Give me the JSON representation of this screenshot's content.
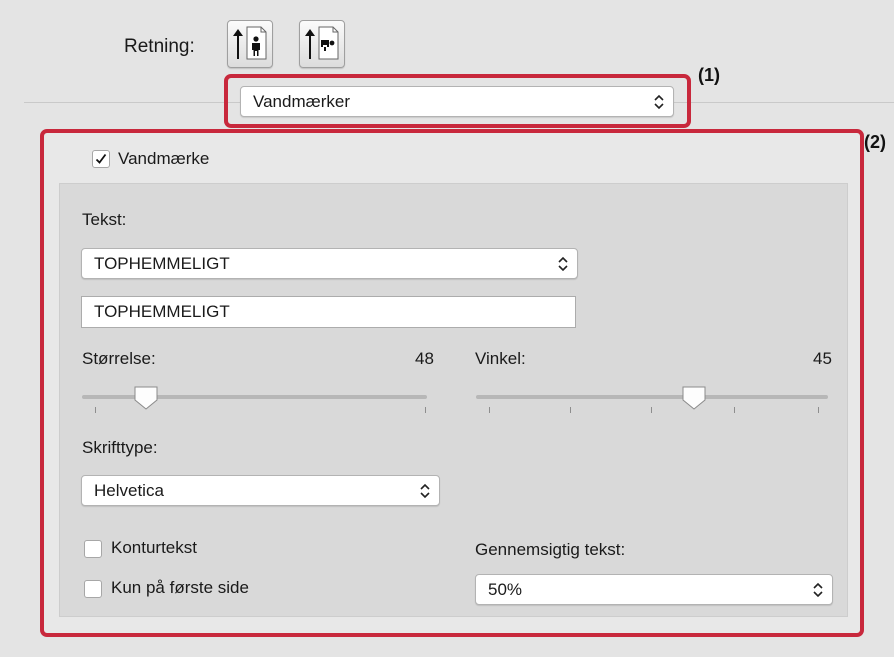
{
  "orientation": {
    "label": "Retning:",
    "portrait_icon": "portrait-orientation-icon",
    "landscape_icon": "landscape-orientation-icon"
  },
  "panel_select": {
    "value": "Vandmærker"
  },
  "callouts": {
    "one": "(1)",
    "two": "(2)"
  },
  "watermark": {
    "enable_label": "Vandmærke",
    "enabled": true,
    "text_label": "Tekst:",
    "text_select": "TOPHEMMELIGT",
    "text_value": "TOPHEMMELIGT",
    "size": {
      "label": "Størrelse:",
      "value": "48"
    },
    "angle": {
      "label": "Vinkel:",
      "value": "45"
    },
    "font_label": "Skrifttype:",
    "font_select": "Helvetica",
    "outline": {
      "label": "Konturtekst",
      "checked": false
    },
    "first_page": {
      "label": "Kun på første side",
      "checked": false
    },
    "transparency": {
      "label": "Gennemsigtig tekst:",
      "value": "50%"
    }
  },
  "colors": {
    "callout": "#c8283c",
    "panel": "#d9d9d9",
    "background": "#e4e4e4"
  }
}
